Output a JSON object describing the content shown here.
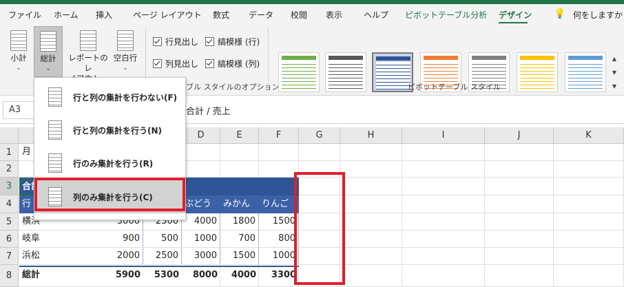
{
  "ribbon_tabs": [
    "ファイル",
    "ホーム",
    "挿入",
    "ページ レイアウト",
    "数式",
    "データ",
    "校閲",
    "表示",
    "ヘルプ",
    "ピボットテーブル分析",
    "デザイン"
  ],
  "tell_me": "何をしますか",
  "layout_group": {
    "subtotals": "小計",
    "grand_totals": "総計",
    "report_layout": [
      "レポートのレ",
      "イアウト"
    ],
    "blank_rows": "空白行"
  },
  "style_options": {
    "row_headers": "行見出し",
    "col_headers": "列見出し",
    "banded_rows": "縞模様 (行)",
    "banded_cols": "縞模様 (列)",
    "group_label": "ブル スタイルのオプション"
  },
  "styles_group_label": "ピボットテーブル スタイル",
  "swatch_colors": [
    "#70ad47",
    "#595959",
    "#2f5597",
    "#ed7d31",
    "#7f7f7f",
    "#ffc000",
    "#5b9bd5"
  ],
  "name_box": "A3",
  "formula": "合計 / 売上",
  "columns": [
    "D",
    "E",
    "F",
    "G",
    "H",
    "I",
    "J",
    "K"
  ],
  "rows": [
    "1",
    "2",
    "3",
    "4",
    "5",
    "6",
    "7",
    "8"
  ],
  "cells": {
    "a1": "月",
    "a3": "合計",
    "a4": "行",
    "header_fruits": [
      "ぶどう",
      "みかん",
      "りんご"
    ],
    "data": [
      {
        "label": "横浜",
        "values": [
          "3000",
          "2300",
          "4000",
          "1800",
          "1500"
        ]
      },
      {
        "label": "岐阜",
        "values": [
          "900",
          "500",
          "1000",
          "700",
          "800"
        ]
      },
      {
        "label": "浜松",
        "values": [
          "2000",
          "2500",
          "3000",
          "1500",
          "1000"
        ]
      }
    ],
    "total_label": "総計",
    "total_values": [
      "5900",
      "5300",
      "8000",
      "4000",
      "3300"
    ]
  },
  "dropdown_items": [
    "行と列の集計を行わない(F)",
    "行と列の集計を行う(N)",
    "行のみ集計を行う(R)",
    "列のみ集計を行う(C)"
  ]
}
